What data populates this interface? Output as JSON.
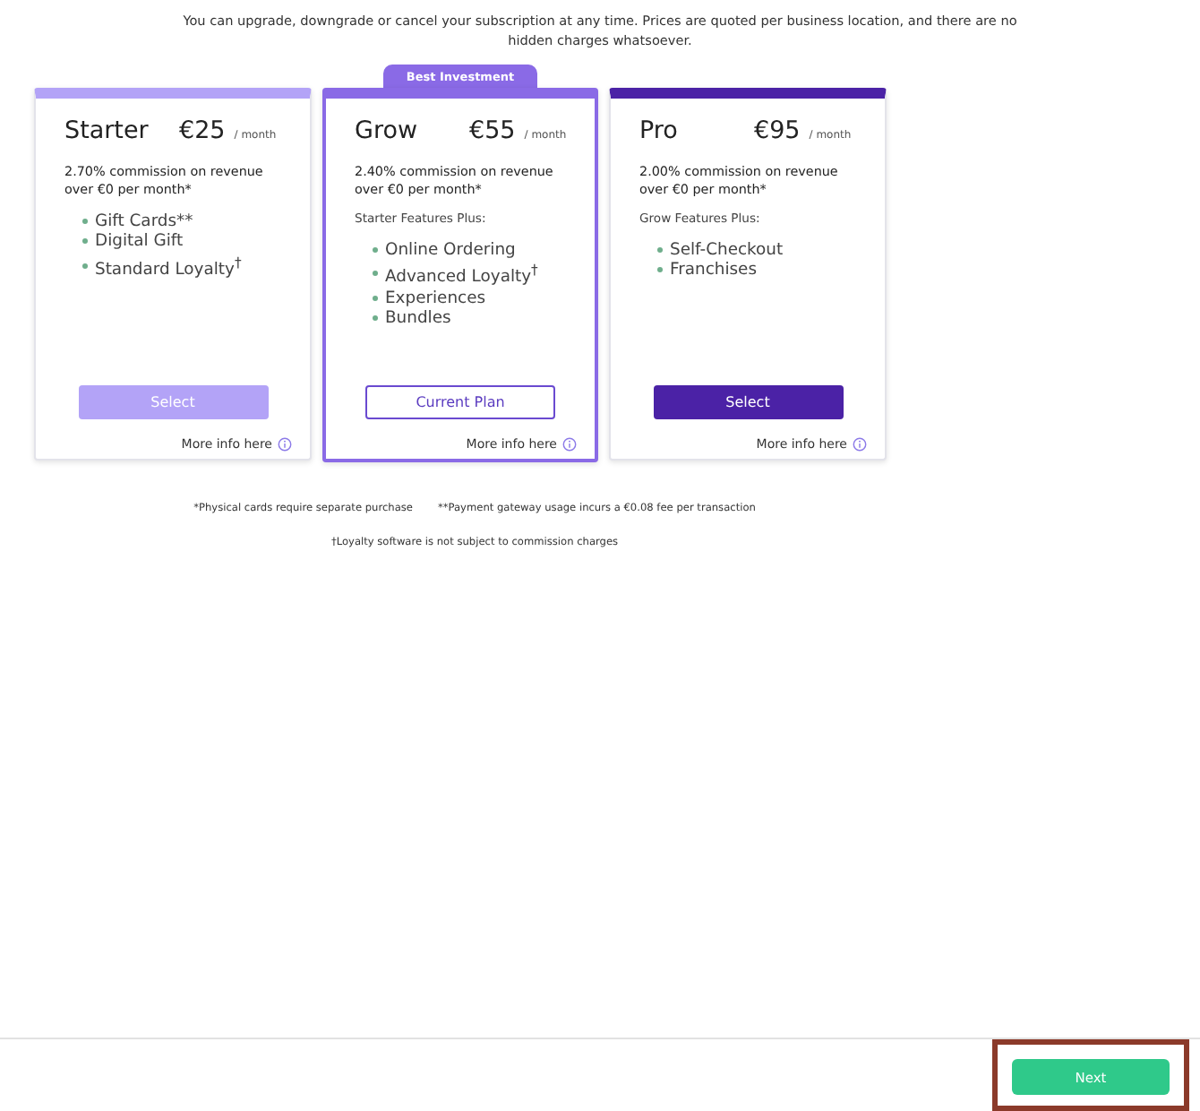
{
  "intro": "You can upgrade, downgrade or cancel your subscription at any time. Prices are quoted per business location, and there are no hidden charges whatsoever.",
  "plans": [
    {
      "name": "Starter",
      "price": "€25",
      "period": "/ month",
      "color": "#b3a3f7",
      "selected": false,
      "commission": "2.70% commission on revenue over €0 per month*",
      "features": [
        "Gift Cards**",
        "Digital Gift",
        "Standard Loyalty$^{†}$"
      ],
      "button": {
        "label": "Select",
        "kind": "disabled"
      },
      "more_info": "More info here"
    },
    {
      "name": "Grow",
      "price": "€55",
      "period": "/ month",
      "color": "#8a6ae6",
      "selected": true,
      "badge": "Best Investment",
      "commission": "2.40% commission on revenue over €0 per month*",
      "features_intro": "Starter Features Plus:",
      "features": [
        "Online Ordering",
        "Advanced Loyalty$^{†}$",
        "Experiences",
        "Bundles"
      ],
      "button": {
        "label": "Current Plan",
        "kind": "current"
      },
      "more_info": "More info here"
    },
    {
      "name": "Pro",
      "price": "€95",
      "period": "/ month",
      "color": "#4b22a6",
      "selected": false,
      "commission": "2.00% commission on revenue over €0 per month*",
      "features_intro": "Grow Features Plus:",
      "features": [
        "Self-Checkout",
        "Franchises"
      ],
      "button": {
        "label": "Select",
        "kind": "primary"
      },
      "more_info": "More info here"
    }
  ],
  "footnotes": [
    "*Physical cards require separate purchase",
    "**Payment gateway usage incurs a €0.08 fee per transaction",
    "†Loyalty software is not subject to commission charges"
  ],
  "next_button": {
    "label": "Next",
    "highlighted": true
  }
}
